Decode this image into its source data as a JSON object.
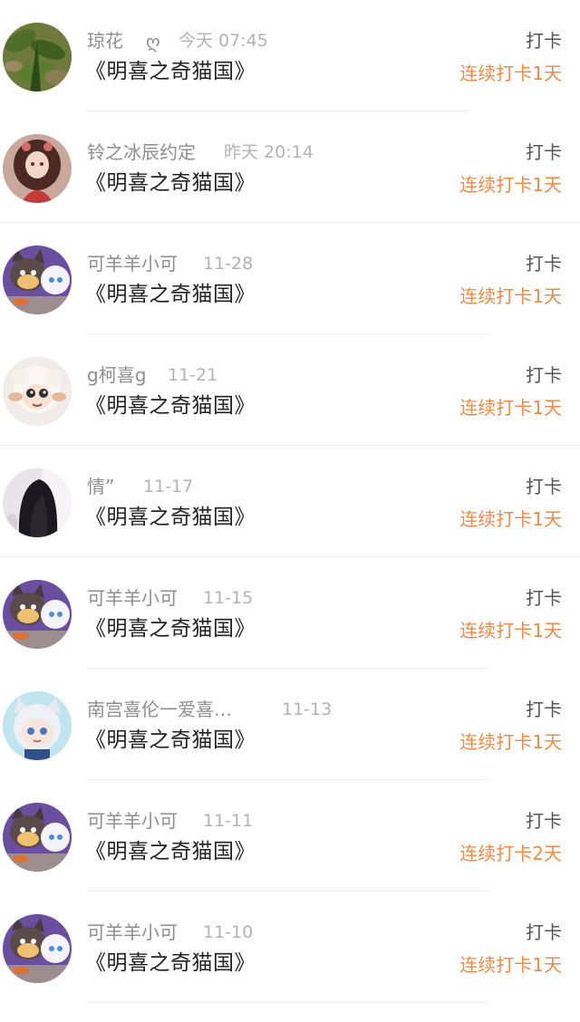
{
  "items": [
    {
      "name": "琼花",
      "heart": "ღ",
      "time": "今天 07:45",
      "title": "《明喜之奇猫国》",
      "type": "打卡",
      "streak": "连续打卡1天",
      "avatar": "green-plant-avatar"
    },
    {
      "name": "铃之冰辰约定",
      "time": "昨天 20:14",
      "title": "《明喜之奇猫国》",
      "type": "打卡",
      "streak": "连续打卡1天",
      "avatar": "anime-girl-avatar"
    },
    {
      "name": "可羊羊小可",
      "time": "11-28",
      "title": "《明喜之奇猫国》",
      "type": "打卡",
      "streak": "连续打卡1天",
      "avatar": "cartoon-cat-sheep-avatar"
    },
    {
      "name": "g柯喜g",
      "time": "11-21",
      "title": "《明喜之奇猫国》",
      "type": "打卡",
      "streak": "连续打卡1天",
      "avatar": "cartoon-sheep-avatar"
    },
    {
      "name": "情”",
      "time": "11-17",
      "title": "《明喜之奇猫国》",
      "type": "打卡",
      "streak": "连续打卡1天",
      "avatar": "dark-hair-girl-avatar"
    },
    {
      "name": "可羊羊小可",
      "time": "11-15",
      "title": "《明喜之奇猫国》",
      "type": "打卡",
      "streak": "连续打卡1天",
      "avatar": "cartoon-cat-sheep-avatar"
    },
    {
      "name": "南宫喜伦一爱喜…",
      "time": "11-13",
      "title": "《明喜之奇猫国》",
      "type": "打卡",
      "streak": "连续打卡1天",
      "avatar": "white-hair-anime-avatar"
    },
    {
      "name": "可羊羊小可",
      "time": "11-11",
      "title": "《明喜之奇猫国》",
      "type": "打卡",
      "streak": "连续打卡2天",
      "avatar": "cartoon-cat-sheep-avatar"
    },
    {
      "name": "可羊羊小可",
      "time": "11-10",
      "title": "《明喜之奇猫国》",
      "type": "打卡",
      "streak": "连续打卡1天",
      "avatar": "cartoon-cat-sheep-avatar"
    }
  ],
  "colors": {
    "accent": "#f08a48",
    "name": "#8e8e8e",
    "time": "#b3b3b3",
    "title": "#222222"
  }
}
